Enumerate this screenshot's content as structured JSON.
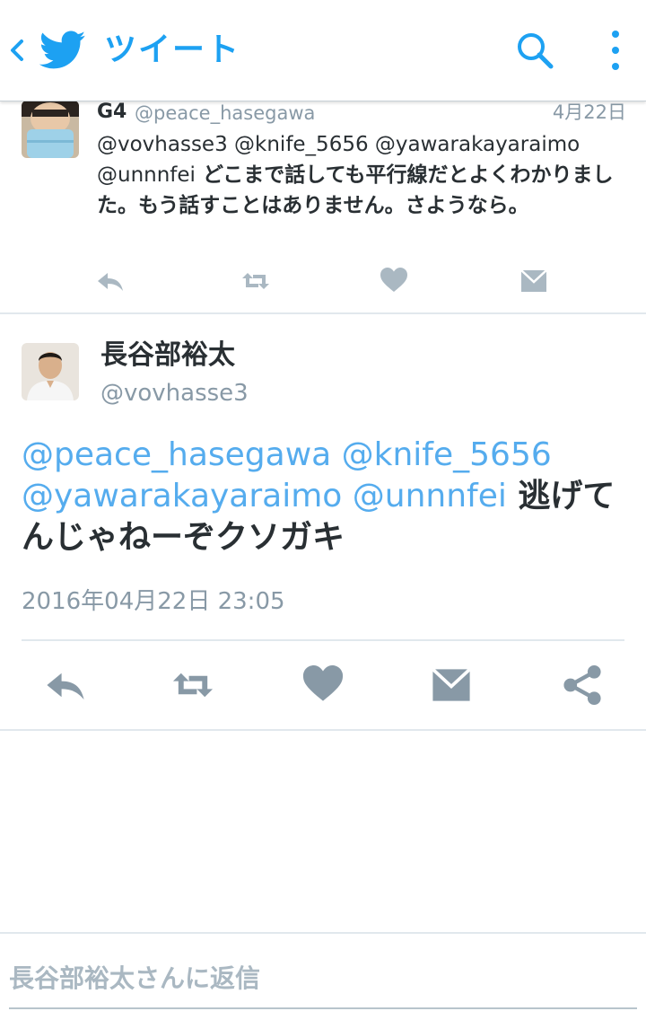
{
  "colors": {
    "accent": "#1da1f2",
    "mention": "#55acee",
    "text": "#292f33",
    "muted": "#8899a6",
    "action_icon": "#8899a6",
    "divider": "#e1e8ed"
  },
  "header": {
    "title": "ツイート",
    "icons": [
      "chevron-left-icon",
      "twitter-bird-icon",
      "search-icon",
      "more-vertical-icon"
    ]
  },
  "previous_tweet": {
    "name": "G4",
    "handle": "@peace_hasegawa",
    "date": "4月22日",
    "mentions": "@vovhasse3 @knife_5656 @yawarakayaraimo @unnnfei",
    "text": "どこまで話しても平行線だとよくわかりました。もう話すことはありません。さようなら。",
    "actions": [
      "reply-icon",
      "retweet-icon",
      "like-icon",
      "dm-icon"
    ]
  },
  "main_tweet": {
    "name": "長谷部裕太",
    "handle": "@vovhasse3",
    "mentions": "@peace_hasegawa @knife_5656 @yawarakayaraimo @unnnfei",
    "text": "逃げてんじゃねーぞクソガキ",
    "datetime": "2016年04月22日 23:05",
    "actions": [
      "reply-icon",
      "retweet-icon",
      "like-icon",
      "dm-icon",
      "share-icon"
    ]
  },
  "reply": {
    "placeholder": "長谷部裕太さんに返信"
  }
}
